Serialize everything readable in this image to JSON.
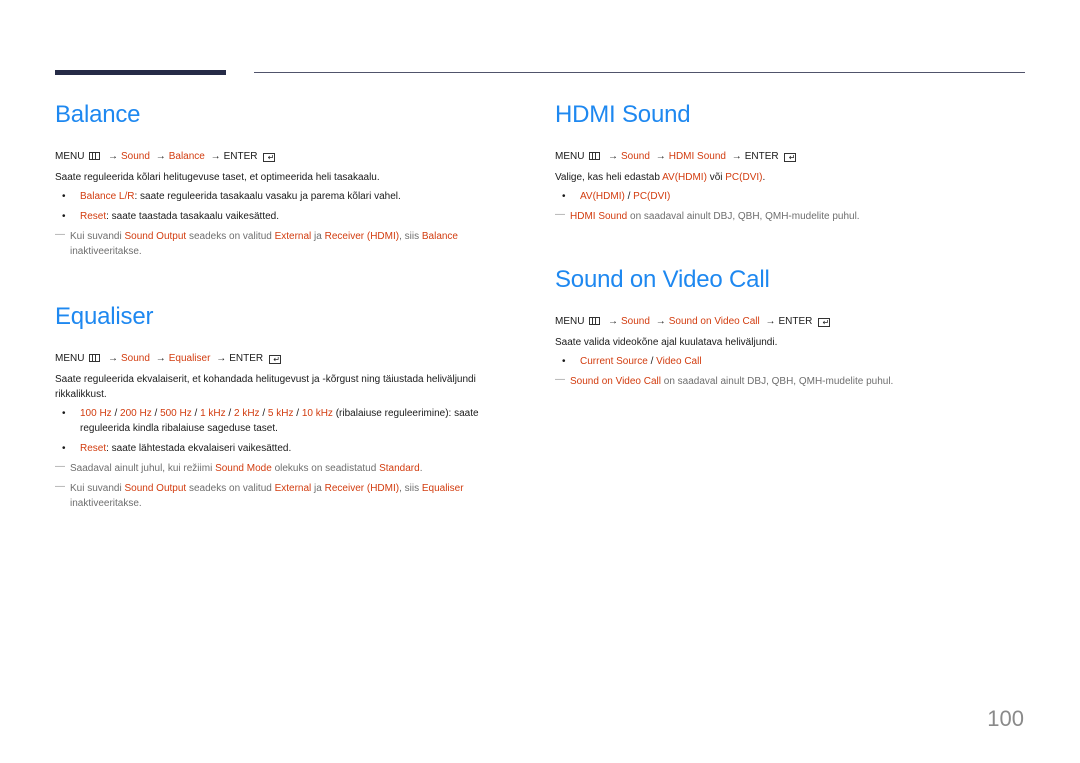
{
  "sections": {
    "balance": {
      "title": "Balance",
      "menu": {
        "menu": "MENU",
        "sound": "Sound",
        "item": "Balance",
        "enter": "ENTER"
      },
      "description": "Saate reguleerida kõlari helitugevuse taset, et optimeerida heli tasakaalu.",
      "bullets": [
        {
          "term": "Balance L/R",
          "text": ": saate reguleerida tasakaalu vasaku ja parema kõlari vahel."
        },
        {
          "term": "Reset",
          "text": ": saate taastada tasakaalu vaikesätted."
        }
      ],
      "notes": [
        {
          "p1": "Kui suvandi ",
          "t1": "Sound Output",
          "p2": " seadeks on valitud ",
          "t2": "External",
          "p3": " ja ",
          "t3": "Receiver (HDMI)",
          "p4": ", siis ",
          "t4": "Balance",
          "p5": " inaktiveeritakse."
        }
      ]
    },
    "equaliser": {
      "title": "Equaliser",
      "menu": {
        "menu": "MENU",
        "sound": "Sound",
        "item": "Equaliser",
        "enter": "ENTER"
      },
      "description": "Saate reguleerida ekvalaiserit, et kohandada helitugevust ja -kõrgust ning täiustada heliväljundi rikkalikkust.",
      "bands": [
        "100 Hz",
        "200 Hz",
        "500 Hz",
        "1 kHz",
        "2 kHz",
        "5 kHz",
        "10 kHz"
      ],
      "bands_text": " (ribalaiuse reguleerimine): saate reguleerida kindla ribalaiuse sageduse taset.",
      "reset": {
        "term": "Reset",
        "text": ": saate lähtestada ekvalaiseri vaikesätted."
      },
      "note1": {
        "p1": "Saadaval ainult juhul, kui režiimi ",
        "t1": "Sound Mode",
        "p2": " olekuks on seadistatud ",
        "t2": "Standard",
        "p3": "."
      },
      "note2": {
        "p1": "Kui suvandi ",
        "t1": "Sound Output",
        "p2": " seadeks on valitud ",
        "t2": "External",
        "p3": " ja ",
        "t3": "Receiver (HDMI)",
        "p4": ", siis ",
        "t4": "Equaliser",
        "p5": " inaktiveeritakse."
      }
    },
    "hdmi_sound": {
      "title": "HDMI Sound",
      "menu": {
        "menu": "MENU",
        "sound": "Sound",
        "item": "HDMI Sound",
        "enter": "ENTER"
      },
      "desc_p1": "Valige, kas heli edastab ",
      "desc_t1": "AV(HDMI)",
      "desc_p2": " või ",
      "desc_t2": "PC(DVI)",
      "desc_p3": ".",
      "option1": "AV(HDMI)",
      "option2": "PC(DVI)",
      "note": {
        "t1": "HDMI Sound",
        "p1": " on saadaval ainult DBJ, QBH, QMH-mudelite puhul."
      }
    },
    "video_call": {
      "title": "Sound on Video Call",
      "menu": {
        "menu": "MENU",
        "sound": "Sound",
        "item": "Sound on Video Call",
        "enter": "ENTER"
      },
      "description": "Saate valida videokõne ajal kuulatava heliväljundi.",
      "option1": "Current Source",
      "option2": "Video Call",
      "note": {
        "t1": "Sound on Video Call",
        "p1": " on saadaval ainult DBJ, QBH, QMH-mudelite puhul."
      }
    }
  },
  "separator": " / ",
  "arrow": "→",
  "bullet": "•",
  "note_dash": "―",
  "page_number": "100",
  "colors": {
    "heading": "#1e88f0",
    "highlight": "#d23c0f",
    "note": "#6e6e6e"
  }
}
